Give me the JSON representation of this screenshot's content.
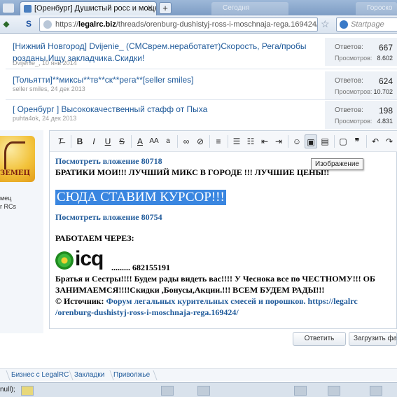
{
  "browser": {
    "tab_title": "[Оренбург] Душистый росс и мощная...",
    "new_tab": "+",
    "inactive_tab_1": "Сегодня",
    "inactive_tab_2": "Гороско",
    "url_prefix": "https://",
    "url_domain": "legalrc.biz",
    "url_path": "/threads/orenburg-dushistyj-ross-i-moschnaja-rega.169424/",
    "search_placeholder": "Startpage"
  },
  "threads": [
    {
      "title": "[Нижний Новгород] Dvijenie_ (СМСврем.неработатет)Скорость, Рега/пробы розданы.Ищу закладчика.Скидки!",
      "author": "Dvijenie_",
      "date": "10 янв 2014",
      "replies_label": "Ответов:",
      "replies": "667",
      "views_label": "Просмотров:",
      "views": "8.602"
    },
    {
      "title": "[Тольятти]**миксы**тв**ск**рега**[seller smiles]",
      "author": "seller smiles",
      "date": "24 дек 2013",
      "replies_label": "Ответов:",
      "replies": "624",
      "views_label": "Просмотров:",
      "views": "10.702"
    },
    {
      "title": "[ Оренбург ] Высококачественный стафф от Пыха",
      "author": "puhta4ok",
      "date": "24 дек 2013",
      "replies_label": "Ответов:",
      "replies": "198",
      "views_label": "Просмотров:",
      "views": "4.831"
    }
  ],
  "user": {
    "avatar_text": "ЗЕМЕЦ",
    "name": "мец",
    "role": "r RCs"
  },
  "toolbar": {
    "tooltip": "Изображение"
  },
  "post": {
    "attach1": "Посмотреть вложение 80718",
    "line1": "БРАТИКИ МОИ!!! ЛУЧШИЙ МИКС В ГОРОДЕ !!! ЛУЧШИЕ ЦЕНЫ!!",
    "highlight": "СЮДА СТАВИМ КУРСОР!!!",
    "attach2": "Посмотреть вложение 80754",
    "work_via": "РАБОТАЕМ ЧЕРЕЗ:",
    "icq_word": "icq",
    "icq_number": "......... 682155191",
    "brothers_line": "Братья и Сестры!!!! Будем рады видеть вас!!!! У Чеснока все по ЧЕСТНОМУ!!! ОБ",
    "engaged_line": "ЗАНИМАЕМСЯ!!!!Скидки ,Бонусы,Акции.!!! ВСЕМ БУДЕМ РАДЫ!!!",
    "source_label": "© Источник:",
    "source_link": "Форум легальных курительных смесей и порошков. https://legalrc",
    "source_path": "/orenburg-dushistyj-ross-i-moschnaja-rega.169424/"
  },
  "actions": {
    "reply": "Ответить",
    "upload": "Загрузить файл"
  },
  "footer": {
    "crumb1": "Бизнес с LegalRC",
    "crumb2": "Закладки",
    "crumb3": "Приволжье"
  },
  "status": {
    "text": "null);"
  }
}
